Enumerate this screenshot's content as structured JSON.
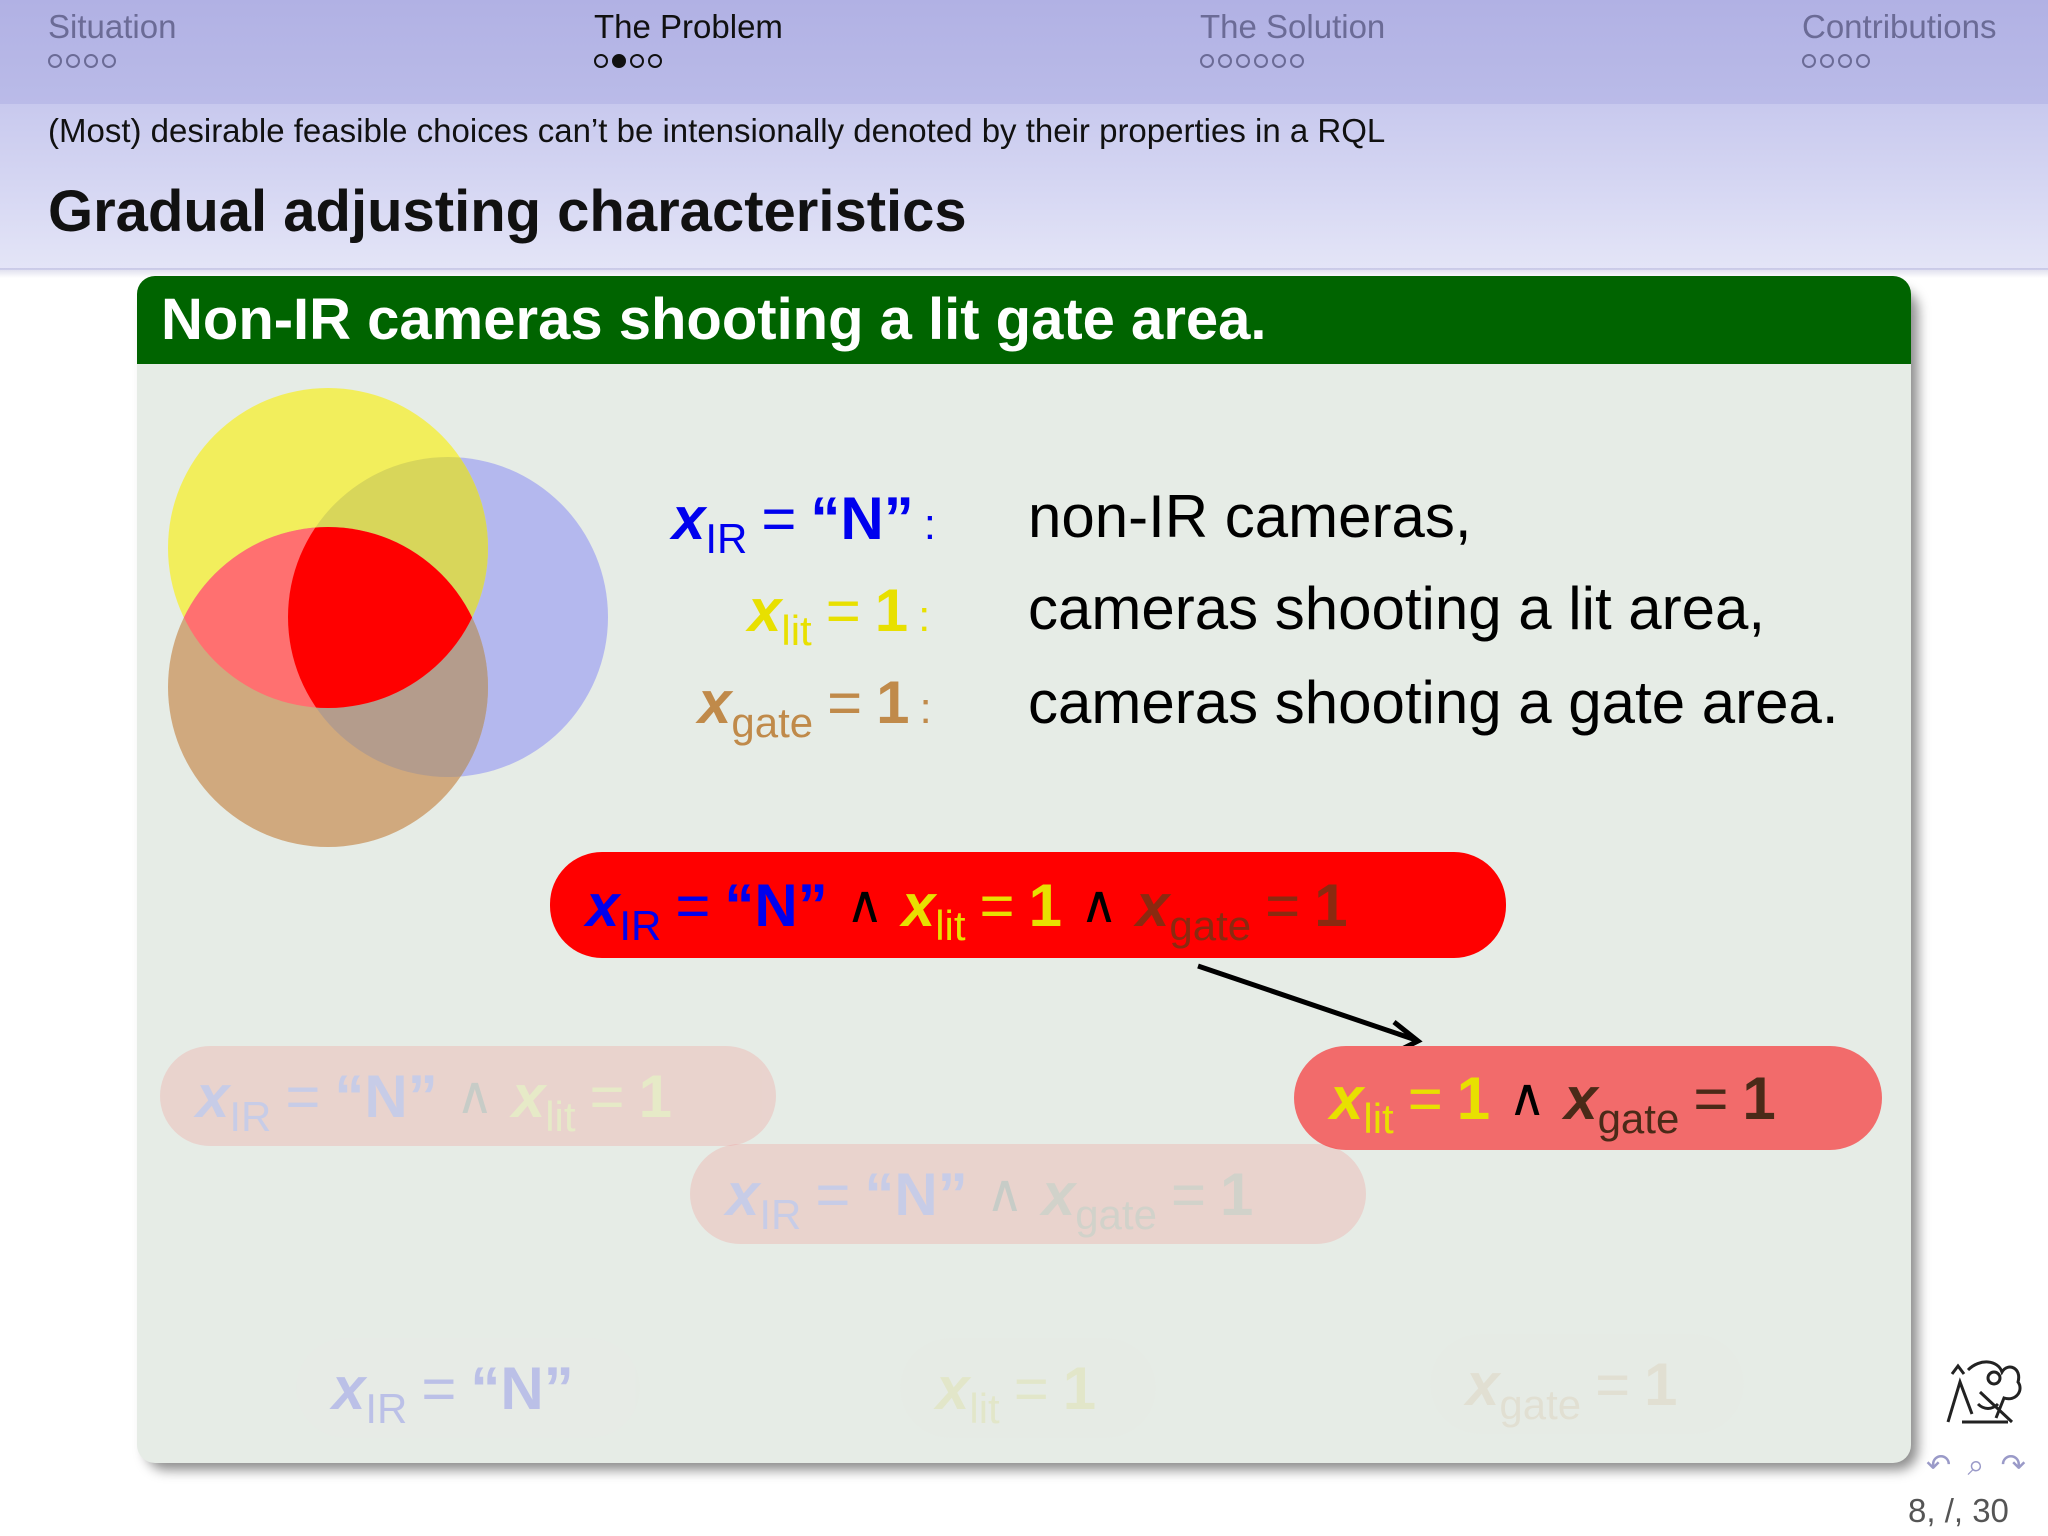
{
  "nav": {
    "sections": [
      {
        "name": "Situation",
        "dots": 4,
        "filled_index": -1,
        "active": false
      },
      {
        "name": "The Problem",
        "dots": 4,
        "filled_index": 1,
        "active": true
      },
      {
        "name": "The Solution",
        "dots": 6,
        "filled_index": -1,
        "active": false
      },
      {
        "name": "Contributions",
        "dots": 4,
        "filled_index": -1,
        "active": false
      }
    ]
  },
  "breadcrumb": "(Most) desirable feasible choices can’t be intensionally denoted by their properties in a RQL",
  "frame_title": "Gradual adjusting characteristics",
  "block": {
    "title": "Non-IR cameras shooting a lit gate area."
  },
  "colors": {
    "ir": "#0000ee",
    "lit": "#e8e000",
    "gate": "#c08a4a",
    "red_pill": "#ff0000",
    "salmon_pill": "#f26b6b",
    "block_head": "#006400",
    "block_body": "#e6ece6"
  },
  "definitions": [
    {
      "var": "x",
      "sub": "IR",
      "eq": "=",
      "val": "“N”",
      "colon": ":",
      "desc": "non-IR cameras,"
    },
    {
      "var": "x",
      "sub": "lit",
      "eq": "=",
      "val": "1",
      "colon": ":",
      "desc": "cameras shooting a lit area,"
    },
    {
      "var": "x",
      "sub": "gate",
      "eq": "=",
      "val": "1",
      "colon": ":",
      "desc": "cameras shooting a gate area."
    }
  ],
  "terms": {
    "x": "x",
    "ir": "IR",
    "lit": "lit",
    "gate": "gate",
    "eq": "=",
    "n": "“N”",
    "one": "1",
    "and": "∧"
  },
  "footer": {
    "nav_symbols": "↶ ⌕ ↷",
    "page": "8, /, 30"
  }
}
